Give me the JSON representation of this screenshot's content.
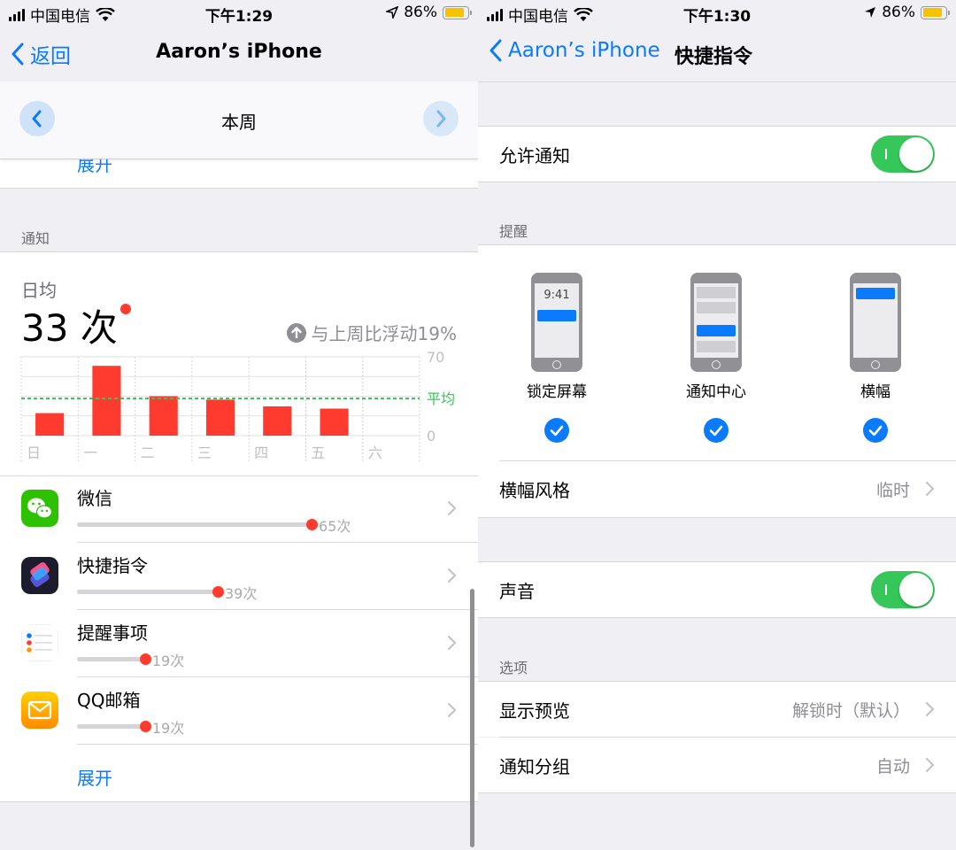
{
  "colors": {
    "accent": "#0a7aff",
    "bar": "#ff3b30",
    "toggle_on": "#35c759",
    "avg_line": "#35c759"
  },
  "left": {
    "status": {
      "carrier": "中国电信",
      "time": "下午1:29",
      "battery": "86%",
      "battery_level": 0.86
    },
    "nav": {
      "back_label": "返回",
      "title": "Aaron’s iPhone"
    },
    "week": {
      "label": "本周"
    },
    "top_expand": "展开",
    "notify_section": "通知",
    "summary": {
      "daily_label": "日均",
      "count": "33 次",
      "change": "与上周比浮动19%"
    },
    "chart_data": {
      "type": "bar",
      "categories": [
        "日",
        "一",
        "二",
        "三",
        "四",
        "五",
        "六"
      ],
      "values": [
        20,
        62,
        35,
        32,
        26,
        24,
        0
      ],
      "ylim": [
        0,
        70
      ],
      "y_ticks": [
        "70",
        "0"
      ],
      "average": 33,
      "average_label": "平均",
      "grid": true
    },
    "apps": [
      {
        "name": "微信",
        "count": "65次",
        "fraction": 1.0,
        "icon": "wechat-icon"
      },
      {
        "name": "快捷指令",
        "count": "39次",
        "fraction": 0.6,
        "icon": "shortcuts-icon"
      },
      {
        "name": "提醒事项",
        "count": "19次",
        "fraction": 0.29,
        "icon": "reminders-icon"
      },
      {
        "name": "QQ邮箱",
        "count": "19次",
        "fraction": 0.29,
        "icon": "qqmail-icon"
      }
    ],
    "bottom_expand": "展开"
  },
  "right": {
    "status": {
      "carrier": "中国电信",
      "time": "下午1:30",
      "battery": "86%",
      "battery_level": 0.86
    },
    "nav": {
      "back_label": "Aaron’s iPhone",
      "title": "快捷指令"
    },
    "allow_notifications": {
      "label": "允许通知",
      "on": true
    },
    "alerts_section": "提醒",
    "alerts": [
      {
        "label": "锁定屏幕",
        "checked": true,
        "lock_time": "9:41"
      },
      {
        "label": "通知中心",
        "checked": true
      },
      {
        "label": "横幅",
        "checked": true
      }
    ],
    "banner_style": {
      "label": "横幅风格",
      "value": "临时"
    },
    "sounds": {
      "label": "声音",
      "on": true
    },
    "options_section": "选项",
    "show_previews": {
      "label": "显示预览",
      "value": "解锁时（默认）"
    },
    "grouping": {
      "label": "通知分组",
      "value": "自动"
    }
  }
}
